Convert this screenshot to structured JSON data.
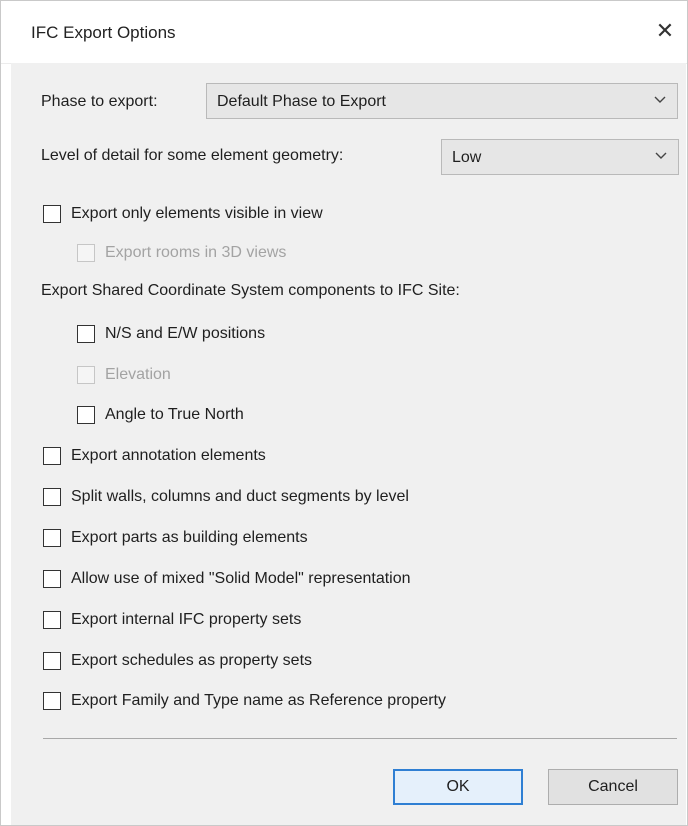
{
  "dialog": {
    "title": "IFC Export Options",
    "close_glyph": "✕"
  },
  "phase": {
    "label": "Phase to export:",
    "selected": "Default Phase to Export"
  },
  "detail": {
    "label": "Level of detail for some element geometry:",
    "selected": "Low"
  },
  "options": {
    "visible_only": "Export only elements visible in view",
    "rooms_3d": "Export rooms in 3D views",
    "shared_coords_heading": "Export Shared Coordinate System components to IFC Site:",
    "ns_ew": "N/S and E/W positions",
    "elevation": "Elevation",
    "true_north": "Angle to True North",
    "annotation": "Export annotation elements",
    "split_walls": "Split walls, columns and duct segments by level",
    "parts": "Export parts as building elements",
    "mixed_solid": "Allow use of mixed \"Solid Model\" representation",
    "internal_psets": "Export internal IFC property sets",
    "schedules": "Export schedules as property sets",
    "family_type": "Export Family and Type name as Reference property"
  },
  "buttons": {
    "ok": "OK",
    "cancel": "Cancel"
  },
  "icons": {
    "close": "close-icon",
    "dropdown": "chevron-down-icon"
  },
  "colors": {
    "client_bg": "#f0f0f0",
    "default_button_border": "#2f7fd3",
    "disabled_text": "#a3a3a3"
  }
}
